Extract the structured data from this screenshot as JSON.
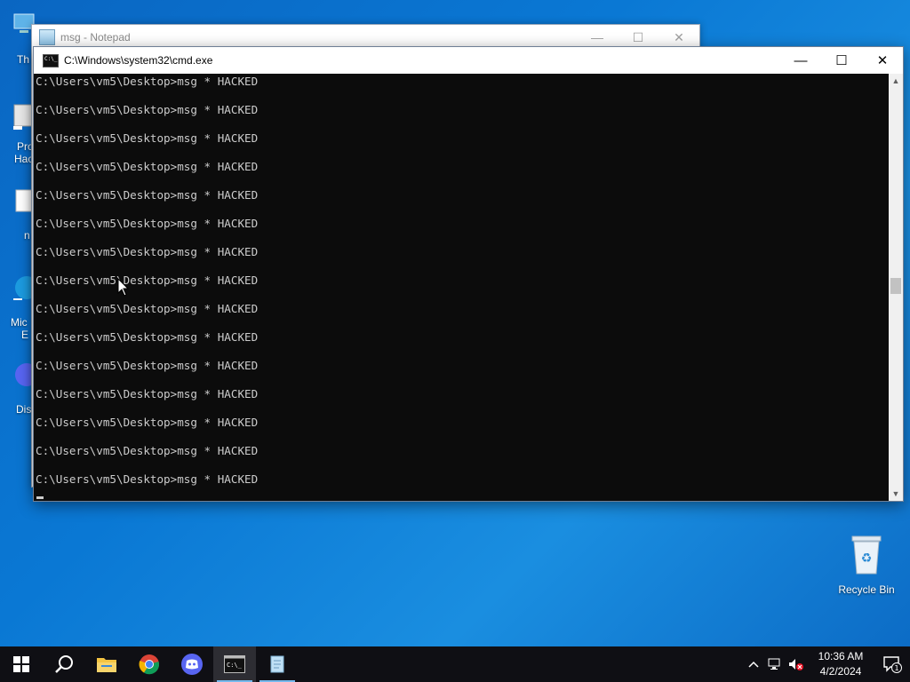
{
  "desktop": {
    "left_icon_labels": [
      "Th",
      "Pro",
      "Hac",
      "n",
      "Mic",
      "E",
      "Dis"
    ],
    "recycle_bin_label": "Recycle Bin"
  },
  "notepad": {
    "title": "msg - Notepad"
  },
  "cmd": {
    "title": "C:\\Windows\\system32\\cmd.exe",
    "lines": [
      "C:\\Users\\vm5\\Desktop>msg * HACKED",
      "C:\\Users\\vm5\\Desktop>msg * HACKED",
      "C:\\Users\\vm5\\Desktop>msg * HACKED",
      "C:\\Users\\vm5\\Desktop>msg * HACKED",
      "C:\\Users\\vm5\\Desktop>msg * HACKED",
      "C:\\Users\\vm5\\Desktop>msg * HACKED",
      "C:\\Users\\vm5\\Desktop>msg * HACKED",
      "C:\\Users\\vm5\\Desktop>msg * HACKED",
      "C:\\Users\\vm5\\Desktop>msg * HACKED",
      "C:\\Users\\vm5\\Desktop>msg * HACKED",
      "C:\\Users\\vm5\\Desktop>msg * HACKED",
      "C:\\Users\\vm5\\Desktop>msg * HACKED",
      "C:\\Users\\vm5\\Desktop>msg * HACKED",
      "C:\\Users\\vm5\\Desktop>msg * HACKED",
      "C:\\Users\\vm5\\Desktop>msg * HACKED"
    ]
  },
  "taskbar": {
    "apps": [
      "start-icon",
      "search-icon",
      "file-explorer-icon",
      "chrome-icon",
      "discord-icon",
      "cmd-icon",
      "notepad-icon"
    ],
    "clock_time": "10:36 AM",
    "clock_date": "4/2/2024",
    "notification_count": "1"
  }
}
